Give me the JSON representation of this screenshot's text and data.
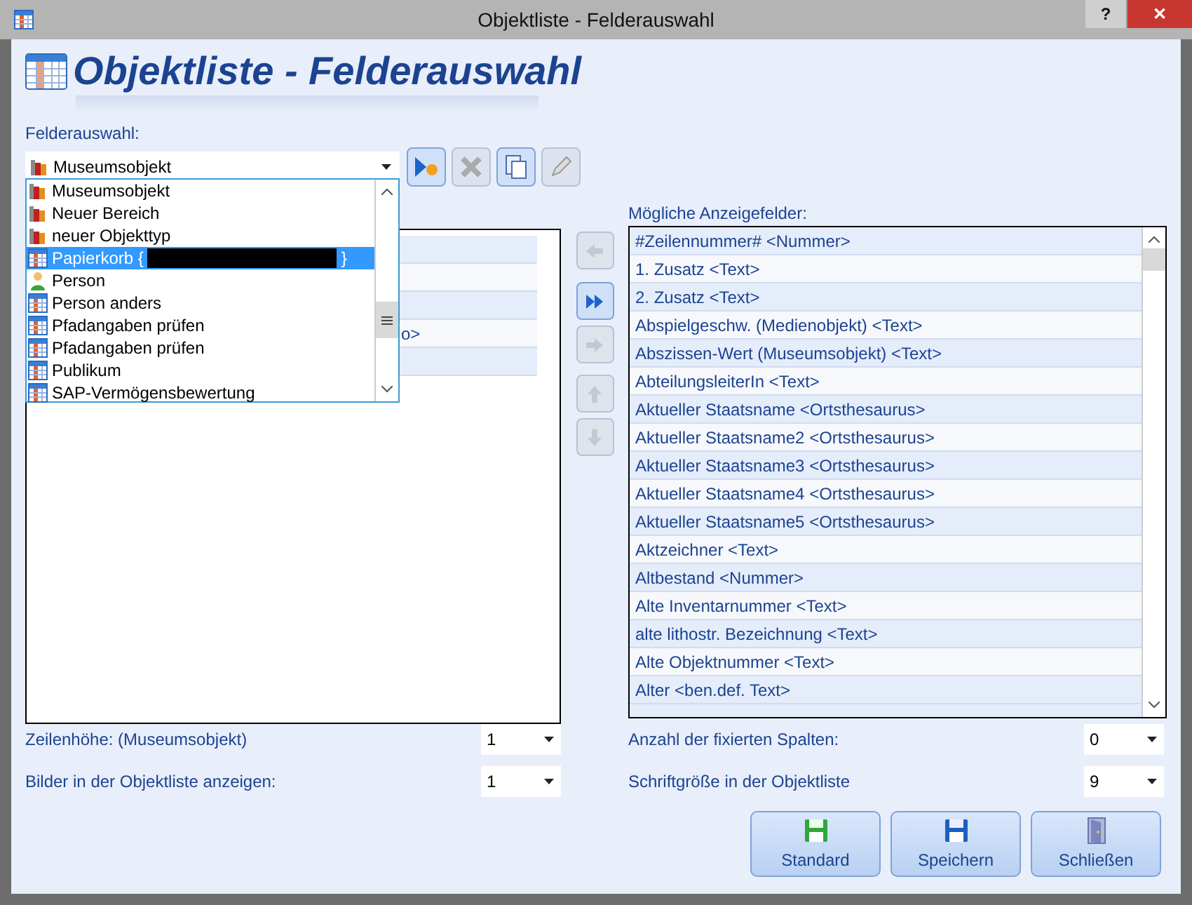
{
  "window": {
    "title": "Objektliste - Felderauswahl",
    "buttons": [
      "?",
      "✕"
    ]
  },
  "heading": "Objektliste - Felderauswahl",
  "field_selection": {
    "label": "Felderauswahl:",
    "value": "Museumsobjekt",
    "kind": "books",
    "dropdown": {
      "expanded": true,
      "items": [
        {
          "label": "Museumsobjekt",
          "kind": "books",
          "selected": false
        },
        {
          "label": "Neuer Bereich",
          "kind": "books",
          "selected": false
        },
        {
          "label": "neuer Objekttyp",
          "kind": "books",
          "selected": false
        },
        {
          "label": "Papierkorb {",
          "kind": "table",
          "selected": true,
          "redacted": true,
          "suffix": "}"
        },
        {
          "label": "Person",
          "kind": "person",
          "selected": false
        },
        {
          "label": "Person anders",
          "kind": "table",
          "selected": false
        },
        {
          "label": "Pfadangaben prüfen",
          "kind": "table",
          "selected": false
        },
        {
          "label": "Pfadangaben prüfen",
          "kind": "table",
          "selected": false
        },
        {
          "label": "Publikum",
          "kind": "table",
          "selected": false
        },
        {
          "label": "SAP-Vermögensbewertung",
          "kind": "table",
          "selected": false
        }
      ]
    }
  },
  "toolbar": [
    {
      "kind": "new",
      "disabled": false
    },
    {
      "kind": "delete",
      "disabled": true
    },
    {
      "kind": "copy",
      "disabled": false
    },
    {
      "kind": "edit",
      "disabled": true
    }
  ],
  "selected_fields": {
    "rows": [
      {
        "shaded": true
      },
      {
        "shaded": false
      },
      {
        "shaded": true
      },
      {
        "shaded": false,
        "text": "o>"
      },
      {
        "shaded": true
      }
    ]
  },
  "move_buttons": [
    {
      "kind": "left",
      "disabled": true
    },
    {
      "kind": "all-right",
      "disabled": false
    },
    {
      "kind": "right",
      "disabled": true
    },
    {
      "kind": "up",
      "disabled": true
    },
    {
      "kind": "down",
      "disabled": true
    }
  ],
  "available_fields": {
    "label": "Mögliche Anzeigefelder:",
    "rows": [
      "#Zeilennummer# <Nummer>",
      "1. Zusatz <Text>",
      "2. Zusatz <Text>",
      "Abspielgeschw. (Medienobjekt) <Text>",
      "Abszissen-Wert (Museumsobjekt) <Text>",
      "AbteilungsleiterIn <Text>",
      "Aktueller Staatsname <Ortsthesaurus>",
      "Aktueller Staatsname2 <Ortsthesaurus>",
      "Aktueller Staatsname3 <Ortsthesaurus>",
      "Aktueller Staatsname4 <Ortsthesaurus>",
      "Aktueller Staatsname5 <Ortsthesaurus>",
      "Aktzeichner <Text>",
      "Altbestand <Nummer>",
      "Alte Inventarnummer <Text>",
      "alte lithostr. Bezeichnung <Text>",
      "Alte Objektnummer <Text>",
      "Alter <ben.def. Text>"
    ]
  },
  "settings_left": [
    {
      "label": "Zeilenhöhe: (Museumsobjekt)",
      "value": "1"
    },
    {
      "label": "Bilder in der Objektliste anzeigen:",
      "value": "1"
    }
  ],
  "settings_right": [
    {
      "label": "Anzahl der fixierten Spalten:",
      "value": "0"
    },
    {
      "label": "Schriftgröße in der Objektliste",
      "value": "9"
    }
  ],
  "buttons": [
    {
      "label": "Standard",
      "kind": "default"
    },
    {
      "label": "Speichern",
      "kind": "save"
    },
    {
      "label": "Schließen",
      "kind": "close"
    }
  ]
}
